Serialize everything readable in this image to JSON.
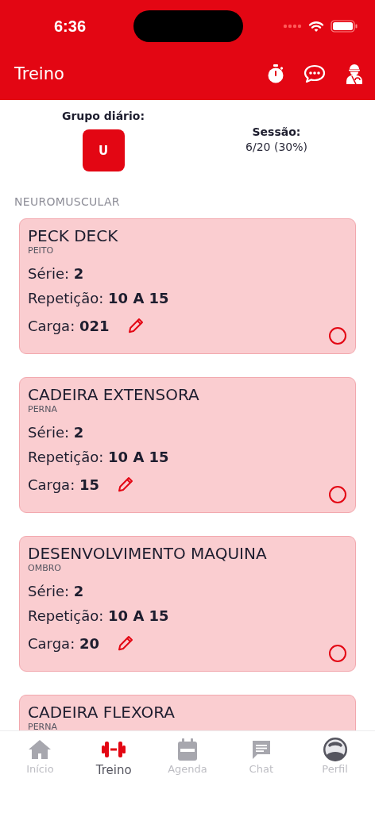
{
  "status_bar": {
    "time": "6:36"
  },
  "header": {
    "title": "Treino"
  },
  "summary": {
    "group_label": "Grupo diário:",
    "group_badge": "U",
    "session_label": "Sessão:",
    "session_value": "6/20 (30%)"
  },
  "section": {
    "title": "NEUROMUSCULAR"
  },
  "exercises": [
    {
      "name": "PECK DECK",
      "group": "PEITO",
      "fields": [
        {
          "kind": "plain",
          "label": "Série:",
          "value": "2"
        },
        {
          "kind": "plain",
          "label": "Repetição:",
          "value": "10 A 15"
        },
        {
          "kind": "editable",
          "label": "Carga:",
          "value": "021"
        }
      ],
      "done": false
    },
    {
      "name": "CADEIRA EXTENSORA",
      "group": "PERNA",
      "fields": [
        {
          "kind": "plain",
          "label": "Série:",
          "value": "2"
        },
        {
          "kind": "plain",
          "label": "Repetição:",
          "value": "10 A 15"
        },
        {
          "kind": "editable",
          "label": "Carga:",
          "value": "15"
        }
      ],
      "done": false
    },
    {
      "name": "DESENVOLVIMENTO MAQUINA",
      "group": "OMBRO",
      "fields": [
        {
          "kind": "plain",
          "label": "Série:",
          "value": "2"
        },
        {
          "kind": "plain",
          "label": "Repetição:",
          "value": "10 A 15"
        },
        {
          "kind": "editable",
          "label": "Carga:",
          "value": "20"
        }
      ],
      "done": false
    },
    {
      "name": "CADEIRA FLEXORA",
      "group": "PERNA"
    }
  ],
  "tab_bar": [
    {
      "kind": "home",
      "label": "Início",
      "selected": false
    },
    {
      "kind": "dumbbell",
      "label": "Treino",
      "selected": true
    },
    {
      "kind": "calendar",
      "label": "Agenda",
      "selected": false
    },
    {
      "kind": "chat",
      "label": "Chat",
      "selected": false
    },
    {
      "kind": "avatar",
      "label": "Perfil",
      "selected": false
    }
  ]
}
